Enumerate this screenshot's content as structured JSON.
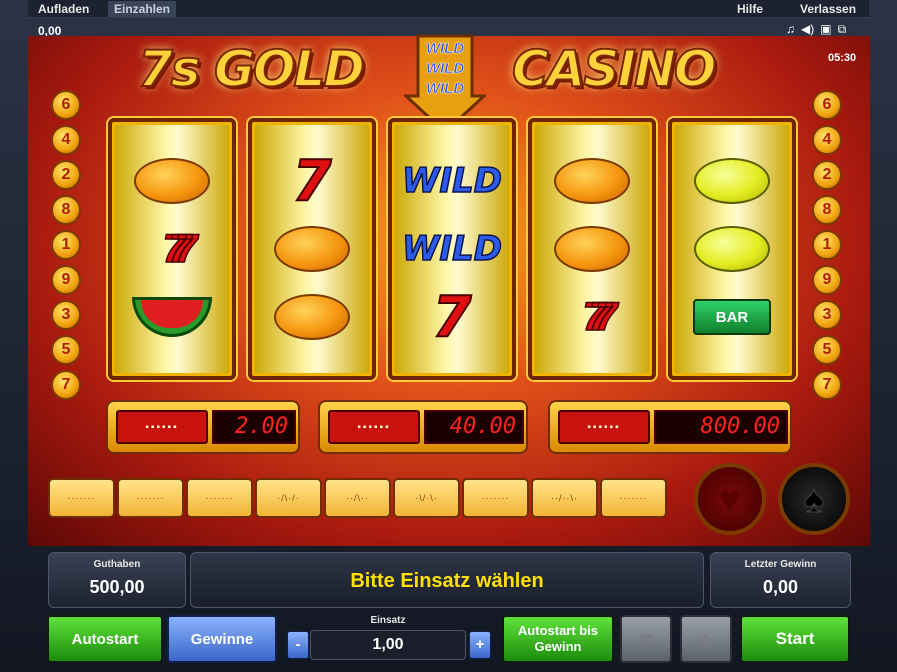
{
  "topbar": {
    "aufladen": "Aufladen",
    "einzahlen": "Einzahlen",
    "hilfe": "Hilfe",
    "verlassen": "Verlassen",
    "credits": "0,00",
    "clock": "05:30",
    "icons": [
      "music-icon",
      "sound-icon",
      "screen-icon",
      "fullscreen-icon"
    ]
  },
  "logo": {
    "left": "7s GOLD",
    "right": "CASINO",
    "wild_lines": [
      "WILD",
      "WILD",
      "WILD"
    ]
  },
  "line_numbers_left": [
    "6",
    "4",
    "2",
    "8",
    "1",
    "9",
    "3",
    "5",
    "7"
  ],
  "line_numbers_right": [
    "6",
    "4",
    "2",
    "8",
    "1",
    "9",
    "3",
    "5",
    "7"
  ],
  "reels": [
    [
      "orange",
      "triple7",
      "melon"
    ],
    [
      "seven",
      "orange",
      "orange"
    ],
    [
      "wild",
      "wild",
      "seven"
    ],
    [
      "orange",
      "orange",
      "triple7"
    ],
    [
      "lemon",
      "lemon",
      "bar"
    ]
  ],
  "symbols": {
    "wild": "WILD",
    "seven": "7",
    "triple7": "777",
    "bar": "BAR"
  },
  "paytable": [
    {
      "value": "2.00"
    },
    {
      "value": "40.00"
    },
    {
      "value": "800.00"
    }
  ],
  "bottom": {
    "guthaben_label": "Guthaben",
    "guthaben_value": "500,00",
    "message": "Bitte Einsatz wählen",
    "letzter_label": "Letzter Gewinn",
    "letzter_value": "0,00",
    "autostart": "Autostart",
    "gewinne": "Gewinne",
    "einsatz_label": "Einsatz",
    "einsatz_value": "1,00",
    "minus": "-",
    "plus": "+",
    "autostart_bis": "Autostart bis Gewinn",
    "start": "Start"
  },
  "colors": {
    "accent_gold": "#ffd13a",
    "led_red": "#ff2020",
    "message_yellow": "#ffe000",
    "button_green": "#2fb81a",
    "button_blue": "#5a86e6"
  }
}
